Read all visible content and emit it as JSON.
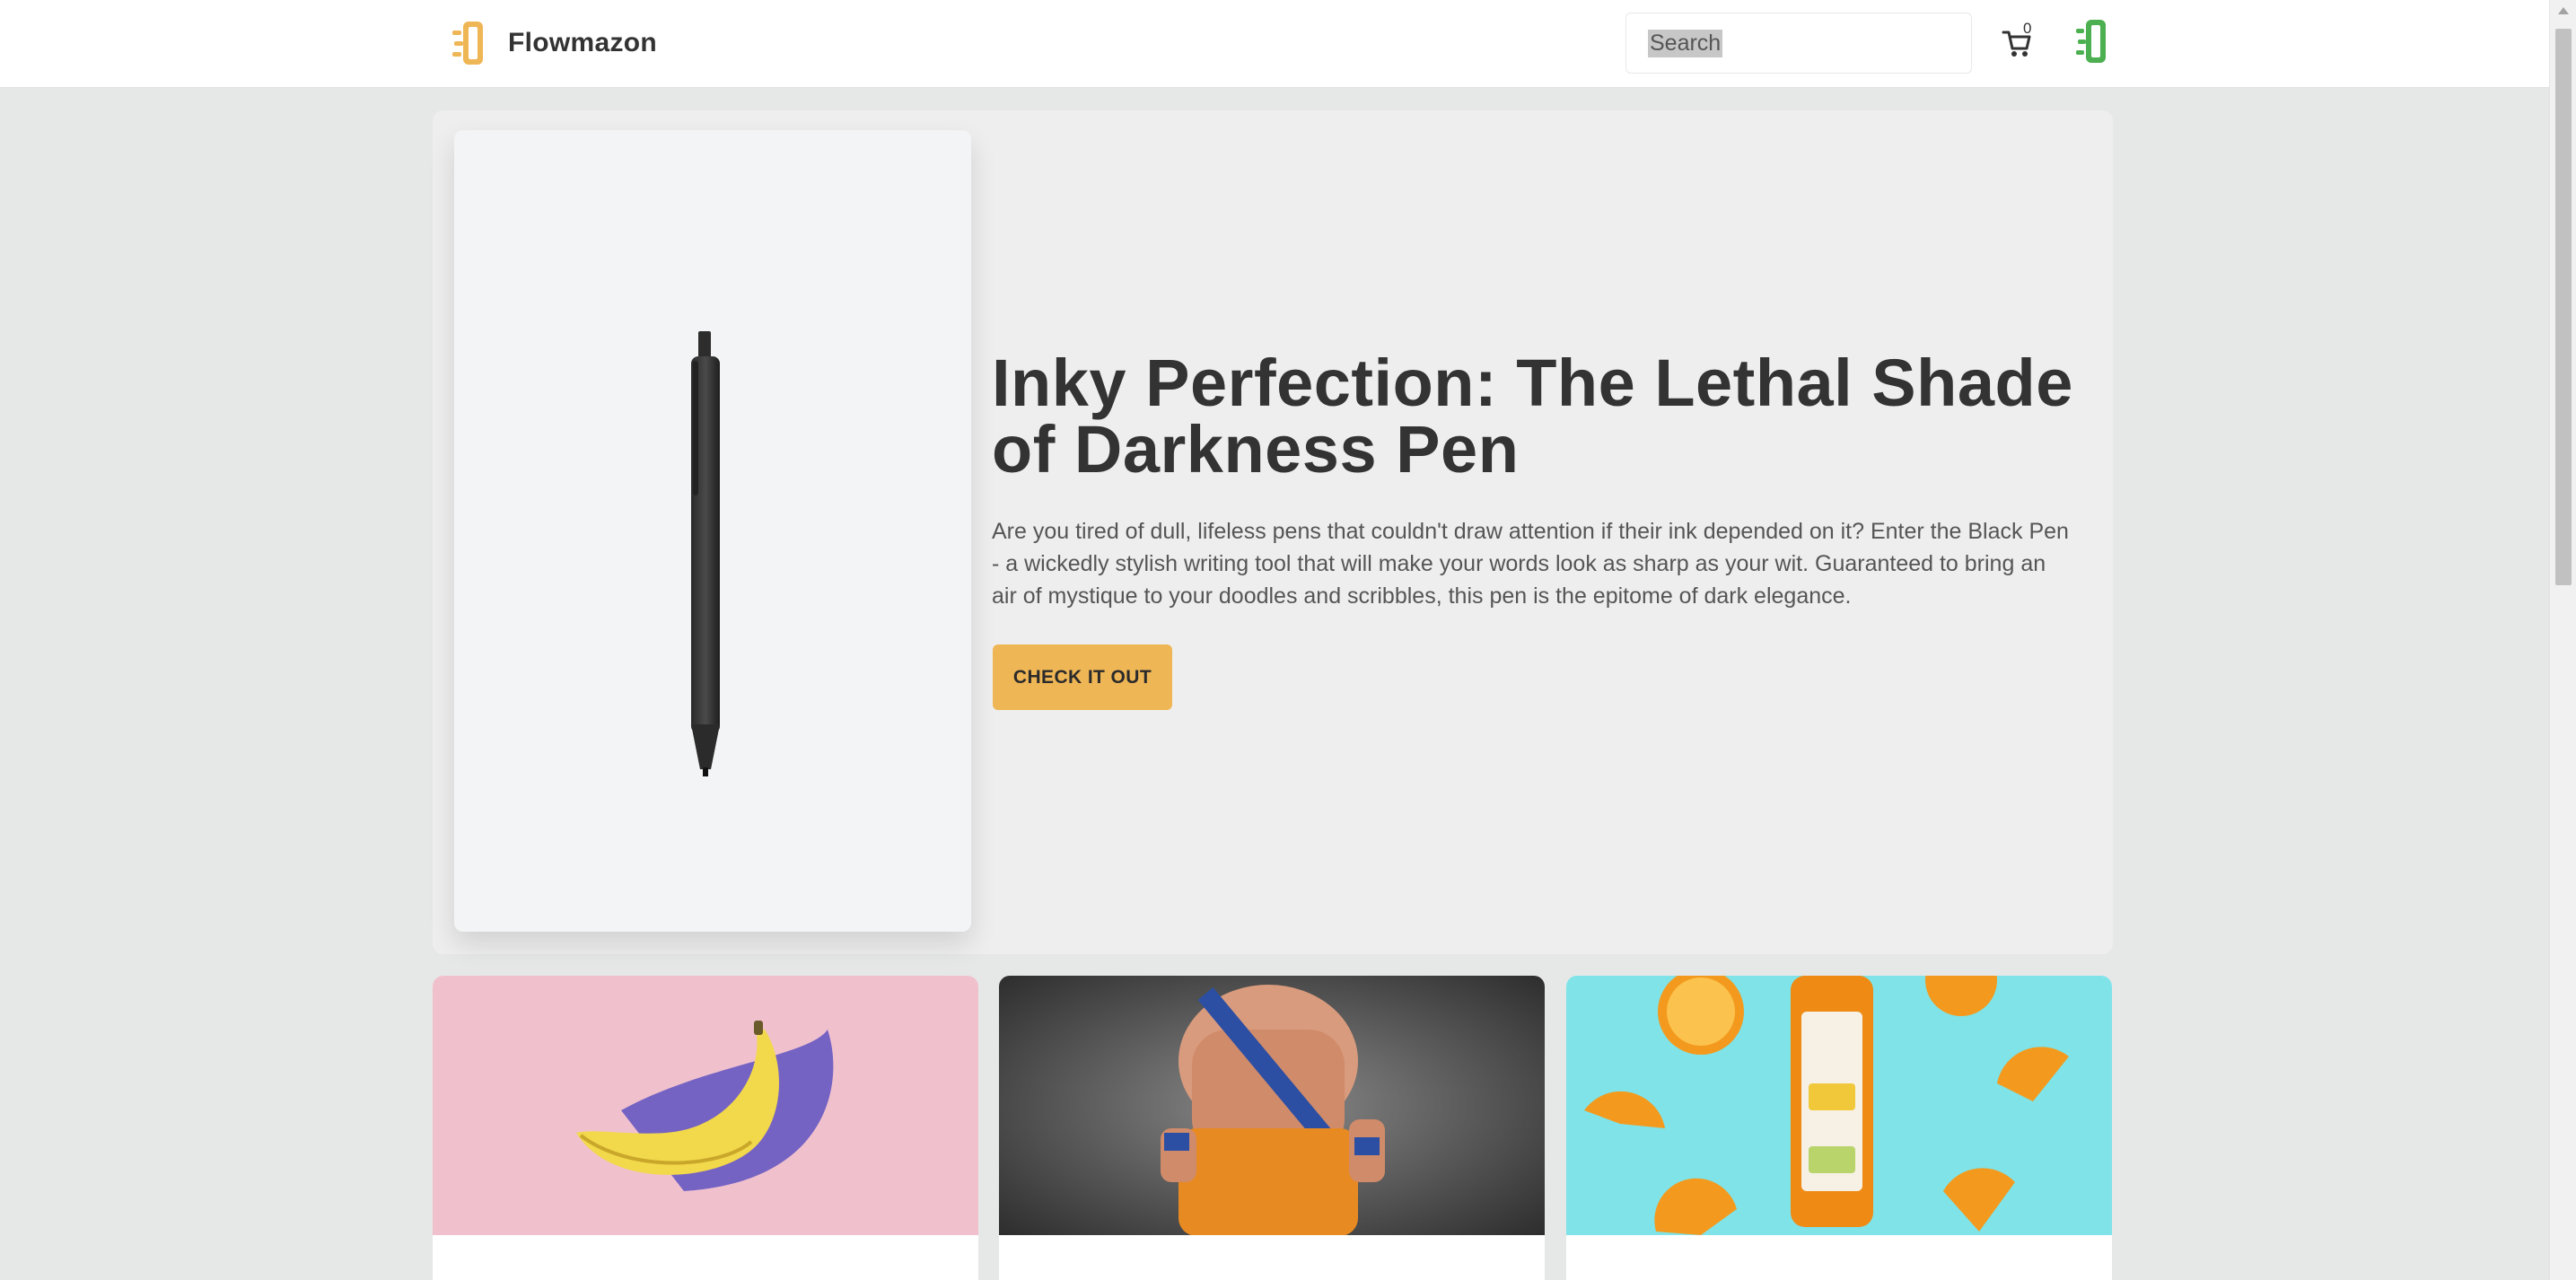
{
  "header": {
    "brand_name": "Flowmazon",
    "search_placeholder": "Search",
    "search_value": "Search",
    "cart_count": "0"
  },
  "hero": {
    "title": "Inky Perfection: The Lethal Shade of Darkness Pen",
    "description": "Are you tired of dull, lifeless pens that couldn't draw attention if their ink depended on it? Enter the Black Pen - a wickedly stylish writing tool that will make your words look as sharp as your wit. Guaranteed to bring an air of mystique to your doodles and scribbles, this pen is the epitome of dark elegance.",
    "cta_label": "CHECK IT OUT"
  },
  "products": [
    {
      "image": "banana-on-pink"
    },
    {
      "image": "action-figure"
    },
    {
      "image": "orange-juice-bottle"
    }
  ],
  "colors": {
    "accent": "#efb656",
    "page_background": "#e6e7e7",
    "hero_background": "#eeeeee",
    "logo_orange": "#efb656",
    "logo_green": "#4caf50"
  },
  "icons": {
    "brand": "flowmazon-logo-icon",
    "cart": "cart-icon",
    "account": "account-logo-icon"
  }
}
